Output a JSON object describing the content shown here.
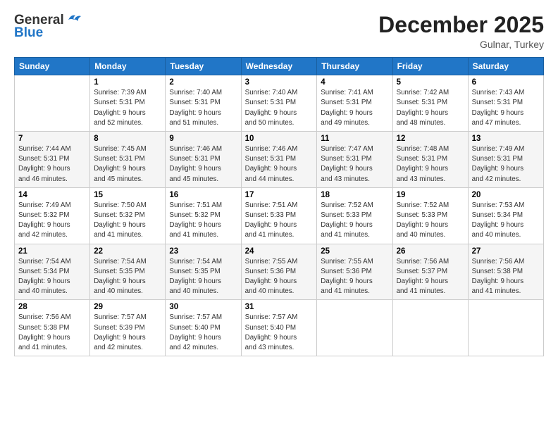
{
  "header": {
    "logo_line1": "General",
    "logo_line2": "Blue",
    "month": "December 2025",
    "location": "Gulnar, Turkey"
  },
  "days_of_week": [
    "Sunday",
    "Monday",
    "Tuesday",
    "Wednesday",
    "Thursday",
    "Friday",
    "Saturday"
  ],
  "weeks": [
    [
      {
        "num": "",
        "info": ""
      },
      {
        "num": "1",
        "info": "Sunrise: 7:39 AM\nSunset: 5:31 PM\nDaylight: 9 hours\nand 52 minutes."
      },
      {
        "num": "2",
        "info": "Sunrise: 7:40 AM\nSunset: 5:31 PM\nDaylight: 9 hours\nand 51 minutes."
      },
      {
        "num": "3",
        "info": "Sunrise: 7:40 AM\nSunset: 5:31 PM\nDaylight: 9 hours\nand 50 minutes."
      },
      {
        "num": "4",
        "info": "Sunrise: 7:41 AM\nSunset: 5:31 PM\nDaylight: 9 hours\nand 49 minutes."
      },
      {
        "num": "5",
        "info": "Sunrise: 7:42 AM\nSunset: 5:31 PM\nDaylight: 9 hours\nand 48 minutes."
      },
      {
        "num": "6",
        "info": "Sunrise: 7:43 AM\nSunset: 5:31 PM\nDaylight: 9 hours\nand 47 minutes."
      }
    ],
    [
      {
        "num": "7",
        "info": "Sunrise: 7:44 AM\nSunset: 5:31 PM\nDaylight: 9 hours\nand 46 minutes."
      },
      {
        "num": "8",
        "info": "Sunrise: 7:45 AM\nSunset: 5:31 PM\nDaylight: 9 hours\nand 45 minutes."
      },
      {
        "num": "9",
        "info": "Sunrise: 7:46 AM\nSunset: 5:31 PM\nDaylight: 9 hours\nand 45 minutes."
      },
      {
        "num": "10",
        "info": "Sunrise: 7:46 AM\nSunset: 5:31 PM\nDaylight: 9 hours\nand 44 minutes."
      },
      {
        "num": "11",
        "info": "Sunrise: 7:47 AM\nSunset: 5:31 PM\nDaylight: 9 hours\nand 43 minutes."
      },
      {
        "num": "12",
        "info": "Sunrise: 7:48 AM\nSunset: 5:31 PM\nDaylight: 9 hours\nand 43 minutes."
      },
      {
        "num": "13",
        "info": "Sunrise: 7:49 AM\nSunset: 5:31 PM\nDaylight: 9 hours\nand 42 minutes."
      }
    ],
    [
      {
        "num": "14",
        "info": "Sunrise: 7:49 AM\nSunset: 5:32 PM\nDaylight: 9 hours\nand 42 minutes."
      },
      {
        "num": "15",
        "info": "Sunrise: 7:50 AM\nSunset: 5:32 PM\nDaylight: 9 hours\nand 41 minutes."
      },
      {
        "num": "16",
        "info": "Sunrise: 7:51 AM\nSunset: 5:32 PM\nDaylight: 9 hours\nand 41 minutes."
      },
      {
        "num": "17",
        "info": "Sunrise: 7:51 AM\nSunset: 5:33 PM\nDaylight: 9 hours\nand 41 minutes."
      },
      {
        "num": "18",
        "info": "Sunrise: 7:52 AM\nSunset: 5:33 PM\nDaylight: 9 hours\nand 41 minutes."
      },
      {
        "num": "19",
        "info": "Sunrise: 7:52 AM\nSunset: 5:33 PM\nDaylight: 9 hours\nand 40 minutes."
      },
      {
        "num": "20",
        "info": "Sunrise: 7:53 AM\nSunset: 5:34 PM\nDaylight: 9 hours\nand 40 minutes."
      }
    ],
    [
      {
        "num": "21",
        "info": "Sunrise: 7:54 AM\nSunset: 5:34 PM\nDaylight: 9 hours\nand 40 minutes."
      },
      {
        "num": "22",
        "info": "Sunrise: 7:54 AM\nSunset: 5:35 PM\nDaylight: 9 hours\nand 40 minutes."
      },
      {
        "num": "23",
        "info": "Sunrise: 7:54 AM\nSunset: 5:35 PM\nDaylight: 9 hours\nand 40 minutes."
      },
      {
        "num": "24",
        "info": "Sunrise: 7:55 AM\nSunset: 5:36 PM\nDaylight: 9 hours\nand 40 minutes."
      },
      {
        "num": "25",
        "info": "Sunrise: 7:55 AM\nSunset: 5:36 PM\nDaylight: 9 hours\nand 41 minutes."
      },
      {
        "num": "26",
        "info": "Sunrise: 7:56 AM\nSunset: 5:37 PM\nDaylight: 9 hours\nand 41 minutes."
      },
      {
        "num": "27",
        "info": "Sunrise: 7:56 AM\nSunset: 5:38 PM\nDaylight: 9 hours\nand 41 minutes."
      }
    ],
    [
      {
        "num": "28",
        "info": "Sunrise: 7:56 AM\nSunset: 5:38 PM\nDaylight: 9 hours\nand 41 minutes."
      },
      {
        "num": "29",
        "info": "Sunrise: 7:57 AM\nSunset: 5:39 PM\nDaylight: 9 hours\nand 42 minutes."
      },
      {
        "num": "30",
        "info": "Sunrise: 7:57 AM\nSunset: 5:40 PM\nDaylight: 9 hours\nand 42 minutes."
      },
      {
        "num": "31",
        "info": "Sunrise: 7:57 AM\nSunset: 5:40 PM\nDaylight: 9 hours\nand 43 minutes."
      },
      {
        "num": "",
        "info": ""
      },
      {
        "num": "",
        "info": ""
      },
      {
        "num": "",
        "info": ""
      }
    ]
  ]
}
